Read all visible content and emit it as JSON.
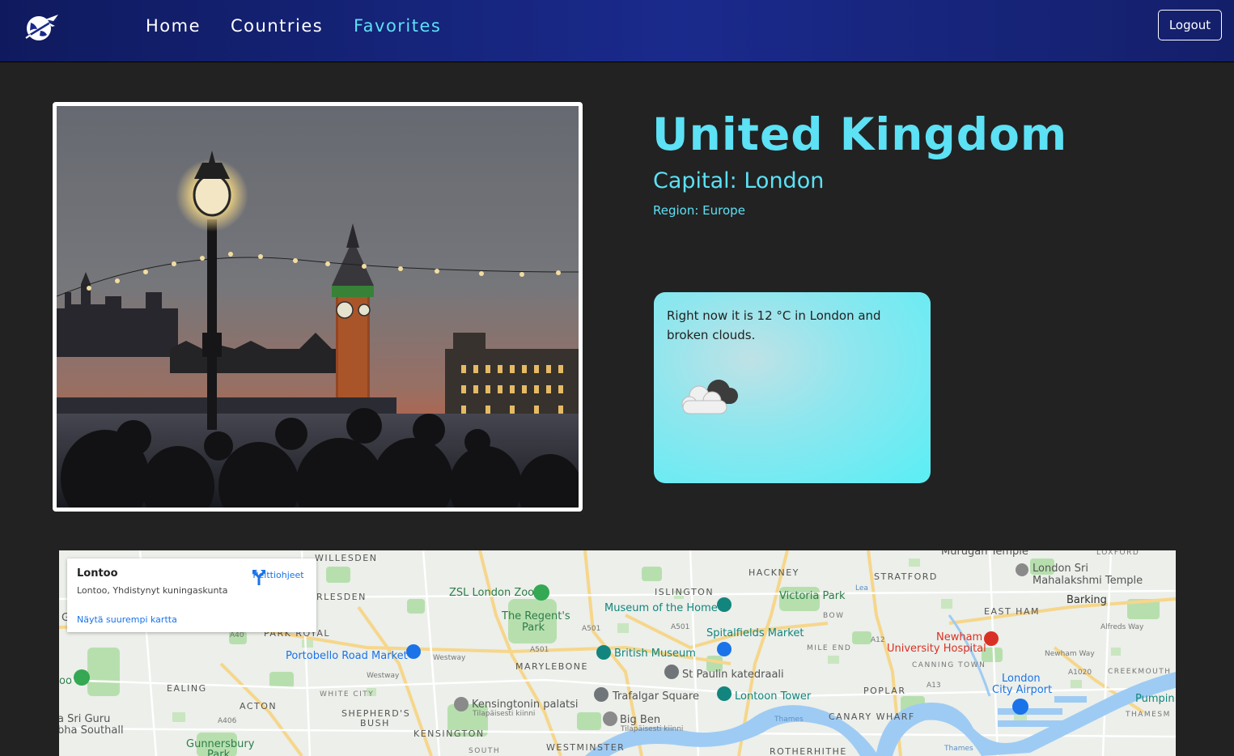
{
  "nav": {
    "links": [
      {
        "label": "Home",
        "active": false
      },
      {
        "label": "Countries",
        "active": false
      },
      {
        "label": "Favorites",
        "active": true
      }
    ],
    "logout_label": "Logout"
  },
  "country": {
    "name": "United Kingdom",
    "capital": "Capital: London",
    "region": "Region: Europe"
  },
  "weather": {
    "text": "Right now it is 12 °C in London and broken clouds.",
    "icon": "broken-clouds-icon"
  },
  "map": {
    "card": {
      "title": "Lontoo",
      "address": "Lontoo, Yhdistynyt kuningaskunta",
      "directions_label": "Reittiohjeet",
      "larger_map_label": "Näytä suurempi kartta"
    },
    "labels": {
      "willesden": "WILLESDEN",
      "harlesden": "RLESDEN",
      "islington": "ISLINGTON",
      "hackney": "HACKNEY",
      "stratford": "STRATFORD",
      "lox": "LOXFORD",
      "murugan": "Murugan Temple",
      "sri1": "London Sri",
      "sri2": "Mahalakshmi Temple",
      "barking": "Barking",
      "eastham": "EAST HAM",
      "newham1": "Newham",
      "newham2": "University Hospital",
      "canning": "CANNING TOWN",
      "creekmouth": "CREEKMOUTH",
      "lcy1": "London",
      "lcy2": "City Airport",
      "thamesmead": "THAMESM",
      "pumping": "Pumpin",
      "zoo": "ZSL London Zoo",
      "regents1": "The Regent's",
      "regents2": "Park",
      "museum_home": "Museum of the Home",
      "victoria": "Victoria Park",
      "bow": "BOW",
      "parkroyal": "PARK ROYAL",
      "portobello": "Portobello Road Market",
      "spitalfields": "Spitalfields Market",
      "mileend": "MILE END",
      "british": "British Museum",
      "marylebone": "MARYLEBONE",
      "stpauls": "St Paulin katedraali",
      "ealing": "EALING",
      "whitecity": "WHITE CITY",
      "kensington_palace": "Kensingtonin palatsi",
      "closed1": "Tilapäisesti kiinni",
      "trafalgar": "Trafalgar Square",
      "towerbridge": "Lontoon Tower",
      "poplar": "POPLAR",
      "acton": "ACTON",
      "shepherds1": "SHEPHERD'S",
      "shepherds2": "BUSH",
      "bigben": "Big Ben",
      "closed2": "Tilapäisesti kiinni",
      "canary": "CANARY WHARF",
      "kensington": "KENSINGTON",
      "westminster": "WESTMINSTER",
      "rotherhithe": "ROTHERHITHE",
      "south": "SOUTH",
      "gunnersbury1": "Gunnersbury",
      "gunnersbury2": "Park",
      "srigu1": "a Sri Guru",
      "srigu2": "bha Southall",
      "westway": "Westway",
      "a501": "A501",
      "a40": "A40",
      "a406": "A406",
      "a12": "A12",
      "a13": "A13",
      "a1020": "A1020",
      "alfreds": "Alfreds Way",
      "newhamway": "Newham Way",
      "thames": "Thames",
      "thames2": "Thames",
      "lea": "Lea",
      "oo": "oo",
      "g": "G"
    }
  },
  "colors": {
    "accent": "#5ce1f5",
    "background": "#222222",
    "nav": "#1a2a8c"
  }
}
